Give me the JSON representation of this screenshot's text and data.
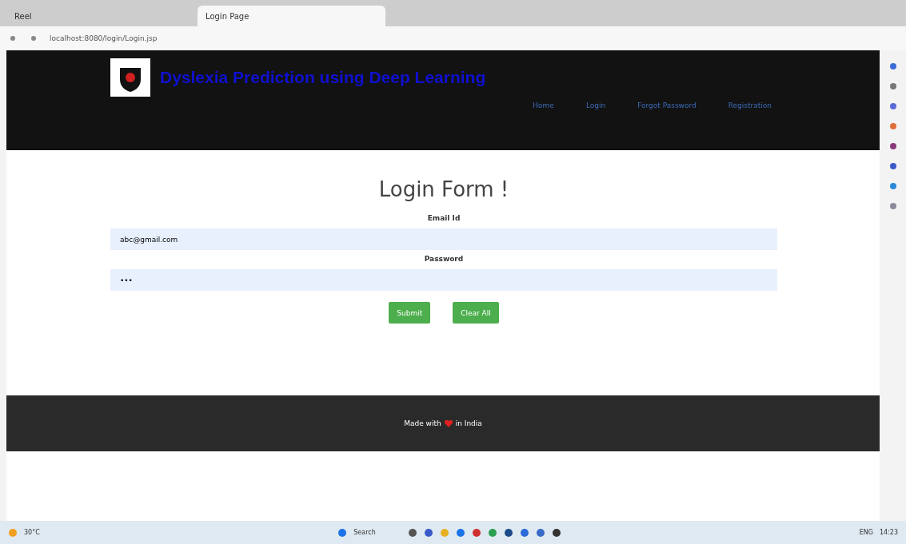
{
  "browser": {
    "tabs": [
      {
        "title": "Reel",
        "selected": false
      },
      {
        "title": "Login Page",
        "selected": true
      }
    ],
    "url": "localhost:8080/login/Login.jsp"
  },
  "header": {
    "title": "Dyslexia Prediction using Deep Learning",
    "nav": [
      {
        "label": "Home"
      },
      {
        "label": "Login"
      },
      {
        "label": "Forgot Password"
      },
      {
        "label": "Registration"
      }
    ]
  },
  "form": {
    "title": "Login Form !",
    "fields": [
      {
        "label": "Email Id",
        "value": "abc@gmail.com"
      },
      {
        "label": "Password",
        "value": "•••"
      }
    ],
    "buttons": [
      "Submit",
      "Clear All"
    ]
  },
  "footer": {
    "before": "Made with",
    "after": "in India"
  },
  "taskbar": {
    "weather": "30°C",
    "search": "Search",
    "language": "ENG",
    "time": "14:23"
  }
}
